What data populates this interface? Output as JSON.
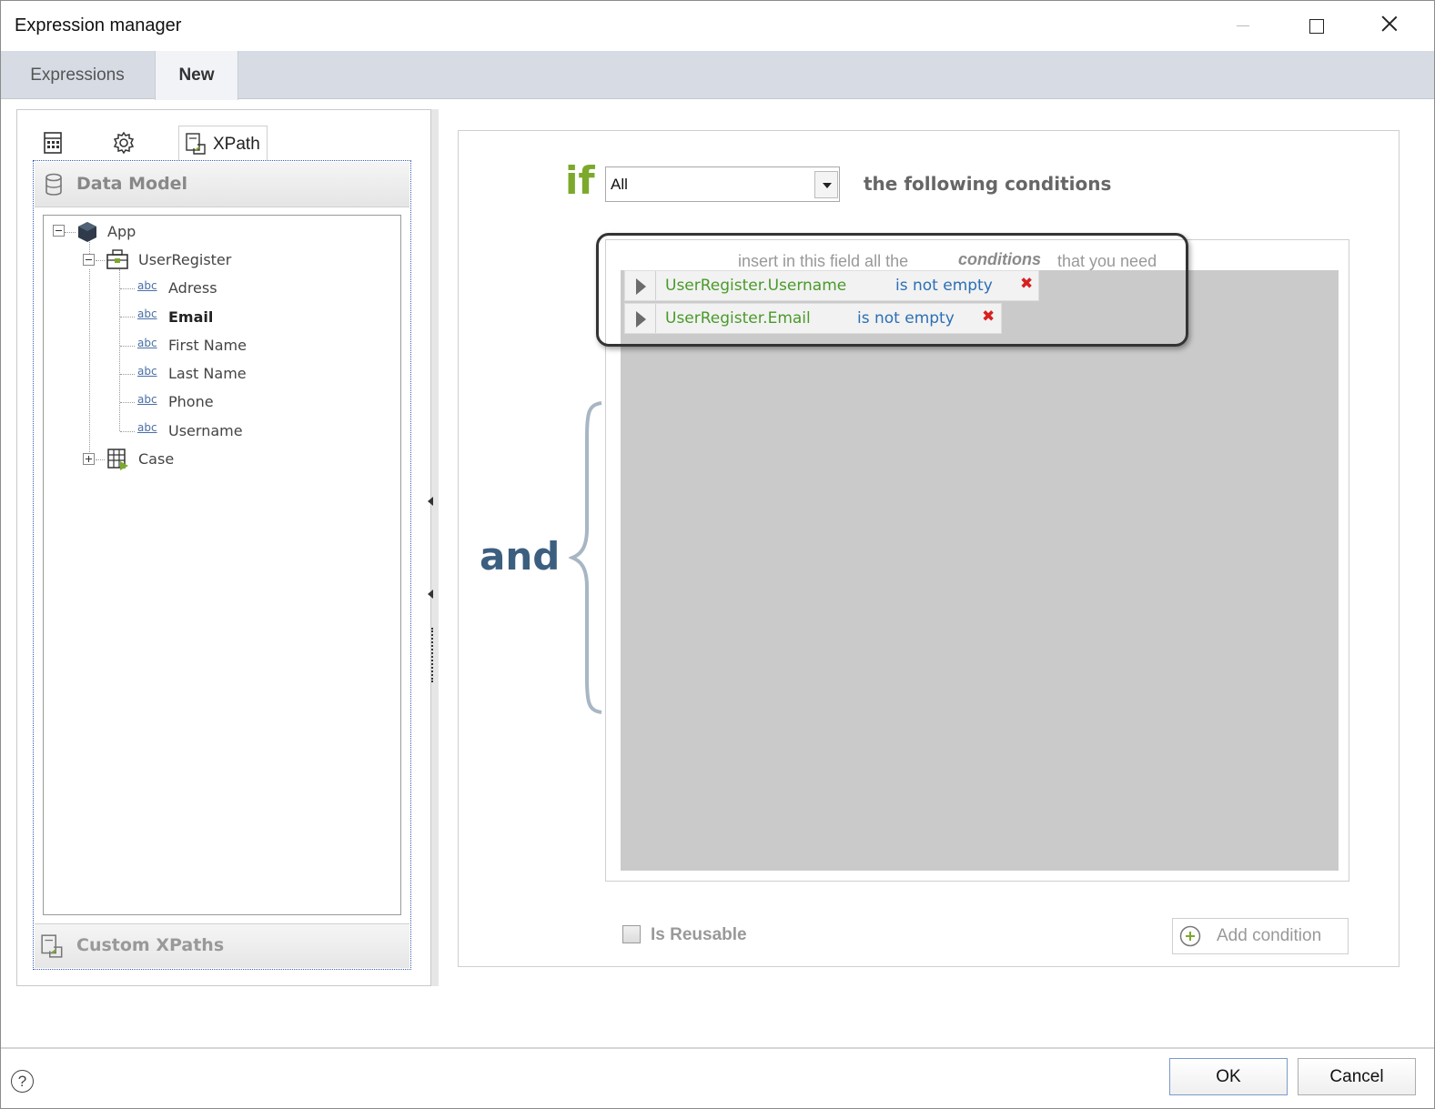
{
  "window": {
    "title": "Expression manager"
  },
  "tabs": [
    {
      "label": "Expressions",
      "active": false
    },
    {
      "label": "New",
      "active": true
    }
  ],
  "left_panel": {
    "toolbar_icons": [
      "table-icon",
      "gear-icon",
      "xpath-icon"
    ],
    "xpath_tab_label": "XPath",
    "data_model_label": "Data Model",
    "custom_xpaths_label": "Custom XPaths",
    "tree": {
      "root": "App",
      "entity": "UserRegister",
      "attributes": [
        "Adress",
        "Email",
        "First Name",
        "Last Name",
        "Phone",
        "Username"
      ],
      "attribute_type": "abc",
      "selected_attribute": "Email",
      "collapsed_node": "Case"
    }
  },
  "rule": {
    "if_word": "if",
    "quantifier": "All",
    "following_text": "the following conditions",
    "hint_prefix": "insert in this field all the",
    "hint_emphasis": "conditions",
    "hint_suffix": "that you need",
    "join_word": "and",
    "conditions": [
      {
        "field": "UserRegister.Username",
        "operator": "is not empty"
      },
      {
        "field": "UserRegister.Email",
        "operator": "is not empty"
      }
    ],
    "is_reusable_label": "Is Reusable",
    "is_reusable_checked": false,
    "add_condition_label": "Add condition"
  },
  "footer": {
    "help_symbol": "?",
    "ok_label": "OK",
    "cancel_label": "Cancel"
  },
  "colors": {
    "if_green": "#7ca92c",
    "field_green": "#4a9a2a",
    "operator_blue": "#2c6fb5",
    "delete_red": "#d82020",
    "and_blue": "#3c5f80"
  }
}
